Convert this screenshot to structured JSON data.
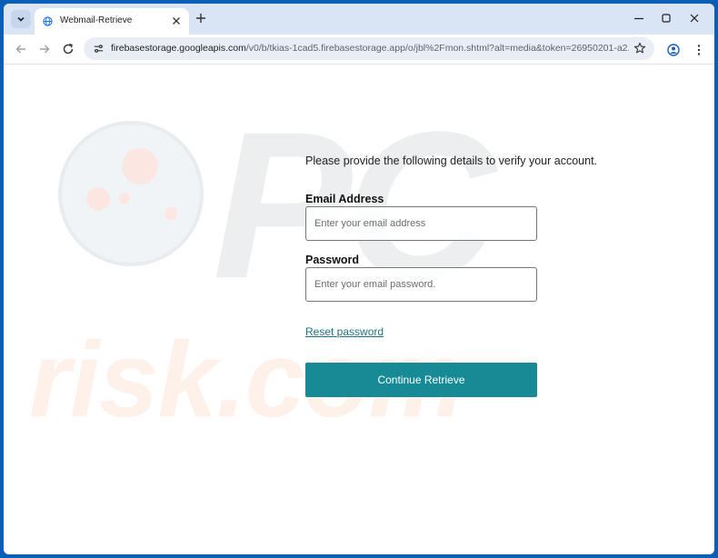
{
  "browser": {
    "tab_title": "Webmail-Retrieve",
    "url_host": "firebasestorage.googleapis.com",
    "url_path": "/v0/b/tkias-1cad5.firebasestorage.app/o/jbl%2Fmon.shtml?alt=media&token=26950201-a2..."
  },
  "watermark": {
    "brand_top": "PC",
    "brand_bottom": "risk.com"
  },
  "form": {
    "intro": "Please provide the following details to verify your account.",
    "email_label": "Email Address",
    "email_placeholder": "Enter your email address",
    "password_label": "Password",
    "password_placeholder": "Enter your email password.",
    "reset_link": "Reset password",
    "submit_label": "Continue Retrieve"
  },
  "colors": {
    "window_accent": "#0a5fb4",
    "tab_strip": "#d9e5f5",
    "button": "#178b95",
    "link": "#1d7483"
  },
  "icons": [
    "tab-list-icon",
    "globe-icon",
    "close-icon",
    "plus-icon",
    "minimize-icon",
    "maximize-icon",
    "back-arrow-icon",
    "forward-arrow-icon",
    "reload-icon",
    "site-info-icon",
    "star-icon",
    "profile-icon",
    "kebab-menu-icon"
  ]
}
